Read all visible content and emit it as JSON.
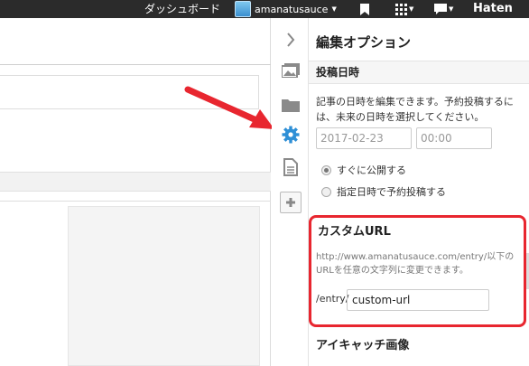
{
  "topbar": {
    "dashboard": "ダッシュボード",
    "user_name": "amanatusauce",
    "brand": "Haten"
  },
  "panel": {
    "title": "編集オプション",
    "post_date": {
      "heading": "投稿日時",
      "description": "記事の日時を編集できます。予約投稿するには、未来の日時を選択してください。",
      "date_placeholder": "2017-02-23",
      "time_placeholder": "00:00",
      "options": [
        {
          "label": "すぐに公開する",
          "selected": true
        },
        {
          "label": "指定日時で予約投稿する",
          "selected": false
        }
      ]
    },
    "custom_url": {
      "heading": "カスタムURL",
      "description": "http://www.amanatusauce.com/entry/以下のURLを任意の文字列に変更できます。",
      "prefix": "/entry/",
      "value": "custom-url"
    },
    "eyecatch": {
      "heading": "アイキャッチ画像"
    }
  },
  "rail_icons": [
    "chevron-right-icon",
    "images-icon",
    "folder-icon",
    "gear-icon",
    "document-icon",
    "plus-icon"
  ],
  "colors": {
    "highlight": "#e8262f",
    "arrow": "#e8262f",
    "gear_active": "#2e8fd6",
    "topbar": "#2b2b2b"
  }
}
